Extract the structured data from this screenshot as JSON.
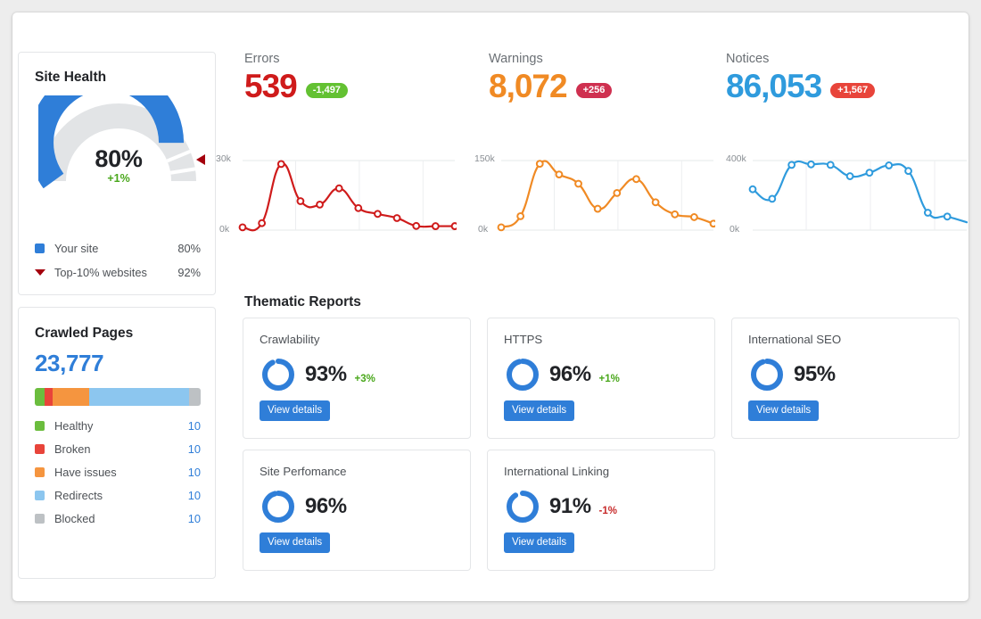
{
  "site_health": {
    "title": "Site Health",
    "score": "80%",
    "delta": "+1%",
    "score_value": 80,
    "benchmark_value": 92,
    "legend": [
      {
        "label": "Your site",
        "value": "80%",
        "marker": "square",
        "color": "#2f7ed8"
      },
      {
        "label": "Top-10% websites",
        "value": "92%",
        "marker": "triangle",
        "color": "#a4000d"
      }
    ]
  },
  "crawled_pages": {
    "title": "Crawled Pages",
    "total": "23,777",
    "segments": [
      {
        "label": "Healthy",
        "value": "10",
        "color": "#6bbd3e",
        "pct": 6
      },
      {
        "label": "Broken",
        "value": "10",
        "color": "#e8443a",
        "pct": 5
      },
      {
        "label": "Have issues",
        "value": "10",
        "color": "#f5953f",
        "pct": 22
      },
      {
        "label": "Redirects",
        "value": "10",
        "color": "#8cc6ef",
        "pct": 60
      },
      {
        "label": "Blocked",
        "value": "10",
        "color": "#bdc1c4",
        "pct": 7
      }
    ]
  },
  "metrics": [
    {
      "label": "Errors",
      "value": "539",
      "badge": "-1,497",
      "badge_color": "#63c132",
      "value_color": "#cf1b1b",
      "axis_top": "30k",
      "axis_bottom": "0k"
    },
    {
      "label": "Warnings",
      "value": "8,072",
      "badge": "+256",
      "badge_color": "#cf3050",
      "value_color": "#f08a24",
      "axis_top": "150k",
      "axis_bottom": "0k"
    },
    {
      "label": "Notices",
      "value": "86,053",
      "badge": "+1,567",
      "badge_color": "#e8443a",
      "value_color": "#2f9bdd",
      "axis_top": "400k",
      "axis_bottom": "0k"
    }
  ],
  "thematic": {
    "heading": "Thematic Reports",
    "button_label": "View details",
    "cards": [
      {
        "title": "Crawlability",
        "pct": "93%",
        "pct_value": 93,
        "delta": "+3%",
        "delta_dir": "up"
      },
      {
        "title": "HTTPS",
        "pct": "96%",
        "pct_value": 96,
        "delta": "+1%",
        "delta_dir": "up"
      },
      {
        "title": "International SEO",
        "pct": "95%",
        "pct_value": 95,
        "delta": "",
        "delta_dir": "none"
      },
      {
        "title": "Site Perfomance",
        "pct": "96%",
        "pct_value": 96,
        "delta": "",
        "delta_dir": "none"
      },
      {
        "title": "International Linking",
        "pct": "91%",
        "pct_value": 91,
        "delta": "-1%",
        "delta_dir": "down"
      }
    ]
  },
  "chart_data": [
    {
      "type": "line",
      "title": "Errors",
      "ylabel": "",
      "xlabel": "",
      "ylim": [
        0,
        30000
      ],
      "yticks": [
        "0k",
        "30k"
      ],
      "grid": true,
      "color": "#cf1b1b",
      "values": [
        1200,
        3000,
        28500,
        12500,
        11000,
        18000,
        9500,
        7000,
        5200,
        1800,
        1700,
        1700
      ]
    },
    {
      "type": "line",
      "title": "Warnings",
      "ylabel": "",
      "xlabel": "",
      "ylim": [
        0,
        150000
      ],
      "yticks": [
        "0k",
        "150k"
      ],
      "grid": true,
      "color": "#f08a24",
      "values": [
        6000,
        30000,
        143000,
        120000,
        100000,
        46000,
        80000,
        110000,
        60000,
        34000,
        28000,
        14000
      ]
    },
    {
      "type": "line",
      "title": "Notices",
      "ylabel": "",
      "xlabel": "",
      "ylim": [
        0,
        400000
      ],
      "yticks": [
        "0k",
        "400k"
      ],
      "grid": true,
      "color": "#2f9bdd",
      "values": [
        235000,
        180000,
        375000,
        378000,
        375000,
        310000,
        330000,
        372000,
        340000,
        100000,
        78000,
        45000
      ]
    }
  ]
}
